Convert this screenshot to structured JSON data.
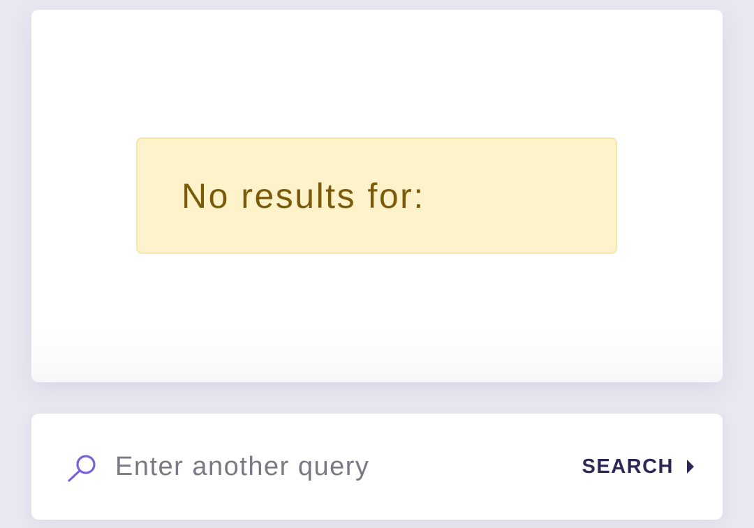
{
  "results": {
    "message": "No results for:"
  },
  "search": {
    "placeholder": "Enter another query",
    "value": "",
    "button_label": "SEARCH",
    "icon": "search-icon",
    "button_icon": "caret-right-icon"
  },
  "colors": {
    "page_background": "#e9e8f1",
    "alert_background": "#fdf2c9",
    "alert_border": "#f8e6a6",
    "alert_text": "#7b5a0a",
    "accent": "#7b61d9",
    "button_text": "#2e2753",
    "placeholder_text": "#7a7882"
  }
}
